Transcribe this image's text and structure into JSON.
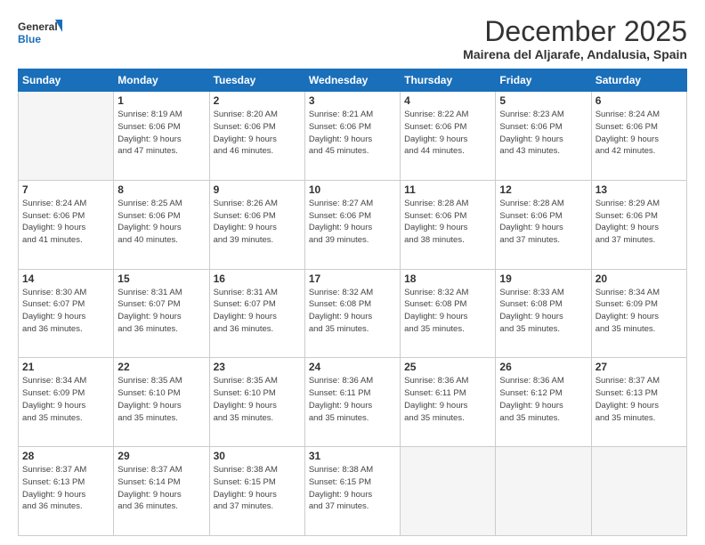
{
  "header": {
    "logo_general": "General",
    "logo_blue": "Blue",
    "title": "December 2025",
    "subtitle": "Mairena del Aljarafe, Andalusia, Spain"
  },
  "days_of_week": [
    "Sunday",
    "Monday",
    "Tuesday",
    "Wednesday",
    "Thursday",
    "Friday",
    "Saturday"
  ],
  "weeks": [
    [
      {
        "day": "",
        "info": "",
        "empty": true
      },
      {
        "day": "1",
        "info": "Sunrise: 8:19 AM\nSunset: 6:06 PM\nDaylight: 9 hours\nand 47 minutes."
      },
      {
        "day": "2",
        "info": "Sunrise: 8:20 AM\nSunset: 6:06 PM\nDaylight: 9 hours\nand 46 minutes."
      },
      {
        "day": "3",
        "info": "Sunrise: 8:21 AM\nSunset: 6:06 PM\nDaylight: 9 hours\nand 45 minutes."
      },
      {
        "day": "4",
        "info": "Sunrise: 8:22 AM\nSunset: 6:06 PM\nDaylight: 9 hours\nand 44 minutes."
      },
      {
        "day": "5",
        "info": "Sunrise: 8:23 AM\nSunset: 6:06 PM\nDaylight: 9 hours\nand 43 minutes."
      },
      {
        "day": "6",
        "info": "Sunrise: 8:24 AM\nSunset: 6:06 PM\nDaylight: 9 hours\nand 42 minutes."
      }
    ],
    [
      {
        "day": "7",
        "info": "Sunrise: 8:24 AM\nSunset: 6:06 PM\nDaylight: 9 hours\nand 41 minutes."
      },
      {
        "day": "8",
        "info": "Sunrise: 8:25 AM\nSunset: 6:06 PM\nDaylight: 9 hours\nand 40 minutes."
      },
      {
        "day": "9",
        "info": "Sunrise: 8:26 AM\nSunset: 6:06 PM\nDaylight: 9 hours\nand 39 minutes."
      },
      {
        "day": "10",
        "info": "Sunrise: 8:27 AM\nSunset: 6:06 PM\nDaylight: 9 hours\nand 39 minutes."
      },
      {
        "day": "11",
        "info": "Sunrise: 8:28 AM\nSunset: 6:06 PM\nDaylight: 9 hours\nand 38 minutes."
      },
      {
        "day": "12",
        "info": "Sunrise: 8:28 AM\nSunset: 6:06 PM\nDaylight: 9 hours\nand 37 minutes."
      },
      {
        "day": "13",
        "info": "Sunrise: 8:29 AM\nSunset: 6:06 PM\nDaylight: 9 hours\nand 37 minutes."
      }
    ],
    [
      {
        "day": "14",
        "info": "Sunrise: 8:30 AM\nSunset: 6:07 PM\nDaylight: 9 hours\nand 36 minutes."
      },
      {
        "day": "15",
        "info": "Sunrise: 8:31 AM\nSunset: 6:07 PM\nDaylight: 9 hours\nand 36 minutes."
      },
      {
        "day": "16",
        "info": "Sunrise: 8:31 AM\nSunset: 6:07 PM\nDaylight: 9 hours\nand 36 minutes."
      },
      {
        "day": "17",
        "info": "Sunrise: 8:32 AM\nSunset: 6:08 PM\nDaylight: 9 hours\nand 35 minutes."
      },
      {
        "day": "18",
        "info": "Sunrise: 8:32 AM\nSunset: 6:08 PM\nDaylight: 9 hours\nand 35 minutes."
      },
      {
        "day": "19",
        "info": "Sunrise: 8:33 AM\nSunset: 6:08 PM\nDaylight: 9 hours\nand 35 minutes."
      },
      {
        "day": "20",
        "info": "Sunrise: 8:34 AM\nSunset: 6:09 PM\nDaylight: 9 hours\nand 35 minutes."
      }
    ],
    [
      {
        "day": "21",
        "info": "Sunrise: 8:34 AM\nSunset: 6:09 PM\nDaylight: 9 hours\nand 35 minutes."
      },
      {
        "day": "22",
        "info": "Sunrise: 8:35 AM\nSunset: 6:10 PM\nDaylight: 9 hours\nand 35 minutes."
      },
      {
        "day": "23",
        "info": "Sunrise: 8:35 AM\nSunset: 6:10 PM\nDaylight: 9 hours\nand 35 minutes."
      },
      {
        "day": "24",
        "info": "Sunrise: 8:36 AM\nSunset: 6:11 PM\nDaylight: 9 hours\nand 35 minutes."
      },
      {
        "day": "25",
        "info": "Sunrise: 8:36 AM\nSunset: 6:11 PM\nDaylight: 9 hours\nand 35 minutes."
      },
      {
        "day": "26",
        "info": "Sunrise: 8:36 AM\nSunset: 6:12 PM\nDaylight: 9 hours\nand 35 minutes."
      },
      {
        "day": "27",
        "info": "Sunrise: 8:37 AM\nSunset: 6:13 PM\nDaylight: 9 hours\nand 35 minutes."
      }
    ],
    [
      {
        "day": "28",
        "info": "Sunrise: 8:37 AM\nSunset: 6:13 PM\nDaylight: 9 hours\nand 36 minutes."
      },
      {
        "day": "29",
        "info": "Sunrise: 8:37 AM\nSunset: 6:14 PM\nDaylight: 9 hours\nand 36 minutes."
      },
      {
        "day": "30",
        "info": "Sunrise: 8:38 AM\nSunset: 6:15 PM\nDaylight: 9 hours\nand 37 minutes."
      },
      {
        "day": "31",
        "info": "Sunrise: 8:38 AM\nSunset: 6:15 PM\nDaylight: 9 hours\nand 37 minutes."
      },
      {
        "day": "",
        "info": "",
        "empty": true
      },
      {
        "day": "",
        "info": "",
        "empty": true
      },
      {
        "day": "",
        "info": "",
        "empty": true
      }
    ]
  ]
}
